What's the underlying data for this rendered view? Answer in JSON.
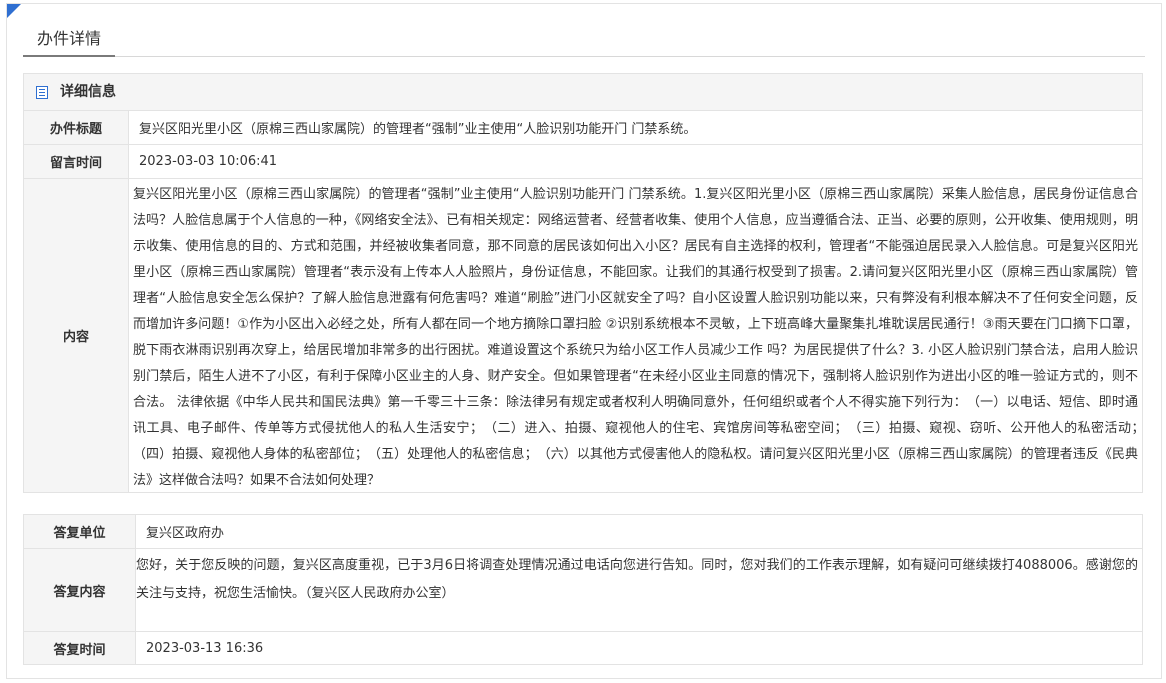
{
  "page": {
    "title": "办件详情"
  },
  "detail": {
    "section_title": "详细信息",
    "title_label": "办件标题",
    "title_value": "复兴区阳光里小区（原棉三西山家属院）的管理者“强制”业主使用“人脸识别功能开门 门禁系统。",
    "time_label": "留言时间",
    "time_value": "2023-03-03 10:06:41",
    "content_label": "内容",
    "content_value": "复兴区阳光里小区（原棉三西山家属院）的管理者“强制”业主使用“人脸识别功能开门 门禁系统。1.复兴区阳光里小区（原棉三西山家属院）采集人脸信息，居民身份证信息合法吗？人脸信息属于个人信息的一种，《网络安全法》、已有相关规定：网络运营者、经营者收集、使用个人信息，应当遵循合法、正当、必要的原则，公开收集、使用规则，明示收集、使用信息的目的、方式和范围，并经被收集者同意，那不同意的居民该如何出入小区？居民有自主选择的权利，管理者“不能强迫居民录入人脸信息。可是复兴区阳光里小区（原棉三西山家属院）管理者“表示没有上传本人人脸照片，身份证信息，不能回家。让我们的其通行权受到了损害。2.请问复兴区阳光里小区（原棉三西山家属院）管理者“人脸信息安全怎么保护？了解人脸信息泄露有何危害吗？难道“刷脸”进门小区就安全了吗？自小区设置人脸识别功能以来，只有弊没有利根本解决不了任何安全问题，反而增加许多问题！①作为小区出入必经之处，所有人都在同一个地方摘除口罩扫脸 ②识别系统根本不灵敏，上下班高峰大量聚集扎堆耽误居民通行！③雨天要在门口摘下口罩，脱下雨衣淋雨识别再次穿上，给居民增加非常多的出行困扰。难道设置这个系统只为给小区工作人员减少工作 吗？为居民提供了什么？3. 小区人脸识别门禁合法，启用人脸识别门禁后，陌生人进不了小区，有利于保障小区业主的人身、财产安全。但如果管理者“在未经小区业主同意的情况下，强制将人脸识别作为进出小区的唯一验证方式的，则不合法。 法律依据《中华人民共和国民法典》第一千零三十三条：除法律另有规定或者权利人明确同意外，任何组织或者个人不得实施下列行为：　（一）以电话、短信、即时通讯工具、电子邮件、传单等方式侵扰他人的私人生活安宁；　（二）进入、拍摄、窥视他人的住宅、宾馆房间等私密空间；　（三）拍摄、窥视、窃听、公开他人的私密活动；　（四）拍摄、窥视他人身体的私密部位；　（五）处理他人的私密信息；　（六）以其他方式侵害他人的隐私权。请问复兴区阳光里小区（原棉三西山家属院）的管理者违反《民典法》这样做合法吗？如果不合法如何处理？"
  },
  "reply": {
    "unit_label": "答复单位",
    "unit_value": "复兴区政府办",
    "content_label": "答复内容",
    "content_value": "您好，关于您反映的问题，复兴区高度重视，已于3月6日将调查处理情况通过电话向您进行告知。同时，您对我们的工作表示理解，如有疑问可继续拨打4088006。感谢您的关注与支持，祝您生活愉快。（复兴区人民政府办公室）",
    "time_label": "答复时间",
    "time_value": "2023-03-13 16:36"
  }
}
